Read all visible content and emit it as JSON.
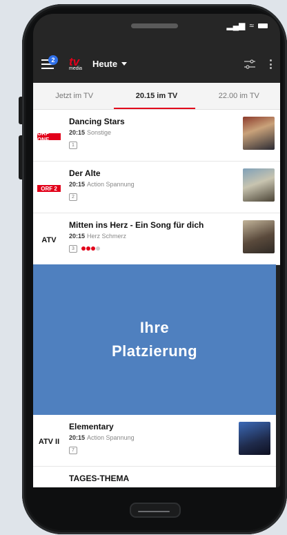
{
  "app_bar": {
    "menu_badge": "2",
    "logo_tv": "tv",
    "logo_media": "media",
    "date_label": "Heute"
  },
  "tabs": [
    {
      "label": "Jetzt im TV",
      "active": false
    },
    {
      "label": "20.15 im TV",
      "active": true
    },
    {
      "label": "22.00 im TV",
      "active": false
    }
  ],
  "listings": [
    {
      "channel": "ORF ONE",
      "title": "Dancing Stars",
      "time": "20:15",
      "genre": "Sonstige",
      "tag": "1",
      "rating": 0
    },
    {
      "channel": "ORF 2",
      "title": "Der Alte",
      "time": "20:15",
      "genre": "Action Spannung",
      "tag": "2",
      "rating": 0
    },
    {
      "channel": "ATV",
      "title": "Mitten ins Herz - Ein Song für dich",
      "time": "20:15",
      "genre": "Herz Schmerz",
      "tag": "3",
      "rating": 3
    }
  ],
  "ad": {
    "line1": "Ihre",
    "line2": "Platzierung"
  },
  "lower_listings": [
    {
      "channel": "ATV II",
      "title": "Elementary",
      "time": "20:15",
      "genre": "Action Spannung",
      "tag": "7"
    },
    {
      "channel": "",
      "title": "TAGES-THEMA",
      "time": "",
      "genre": "",
      "tag": ""
    }
  ],
  "colors": {
    "accent": "#e2001a",
    "ad_background": "#4f80bf",
    "badge": "#2f6fe8"
  }
}
